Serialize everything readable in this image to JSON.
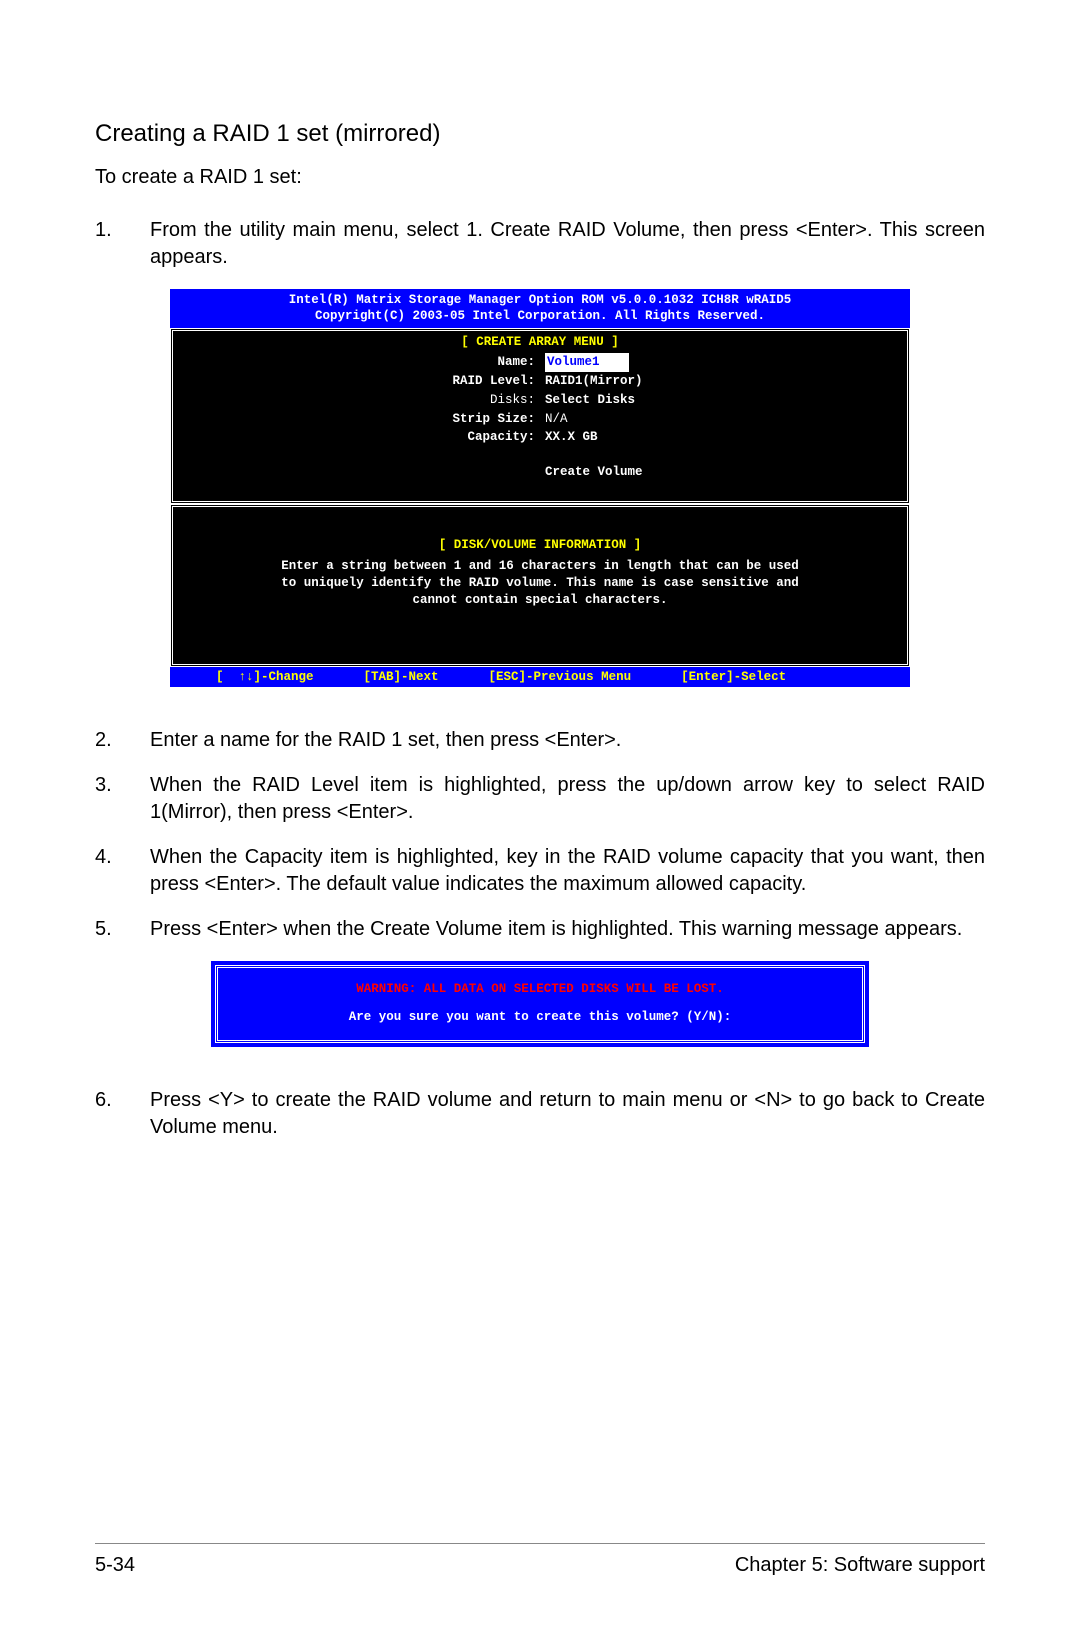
{
  "title": "Creating a RAID 1 set (mirrored)",
  "intro": "To create a RAID 1 set:",
  "steps": {
    "s1": "From the utility main menu, select 1. Create RAID Volume, then press <Enter>. This screen appears.",
    "s2": "Enter a name for the RAID 1 set, then press <Enter>.",
    "s3": "When the RAID Level item is highlighted, press the up/down arrow key to select RAID 1(Mirror), then press <Enter>.",
    "s4": "When the Capacity item is highlighted, key in the RAID volume capacity that you want, then press <Enter>. The default value indicates the maximum allowed capacity.",
    "s5": "Press <Enter> when the Create Volume item is highlighted. This warning message appears.",
    "s6": "Press <Y> to create the RAID volume and return to main menu or <N> to go back to Create Volume menu."
  },
  "bios": {
    "header1": "Intel(R) Matrix Storage Manager Option ROM v5.0.0.1032 ICH8R wRAID5",
    "header2": "Copyright(C) 2003-05 Intel Corporation. All Rights Reserved.",
    "panel1_title": "[ CREATE ARRAY MENU ]",
    "fields": {
      "name_lbl": "Name:",
      "name_val": "Volume1",
      "raid_lbl": "RAID Level:",
      "raid_val": "RAID1(Mirror)",
      "disks_lbl": "Disks:",
      "disks_val": "Select Disks",
      "strip_lbl": "Strip Size:",
      "strip_val": "N/A",
      "cap_lbl": "Capacity:",
      "cap_val": "XX.X  GB",
      "create_volume": "Create Volume"
    },
    "panel2_title": "[ DISK/VOLUME INFORMATION ]",
    "help1": "Enter a string between 1 and 16 characters in length that can be used",
    "help2": "to uniquely identify the RAID volume. This name is case sensitive and",
    "help3": "cannot contain special characters.",
    "footer_change": "[  ↑↓]-Change",
    "footer_tab": "[TAB]-Next",
    "footer_esc": "[ESC]-Previous Menu",
    "footer_enter": "[Enter]-Select"
  },
  "warning": {
    "line1": "WARNING: ALL DATA ON SELECTED DISKS WILL BE LOST.",
    "line2": "Are you sure you want to create this volume? (Y/N):"
  },
  "footer": {
    "page": "5-34",
    "chapter": "Chapter 5: Software support"
  }
}
